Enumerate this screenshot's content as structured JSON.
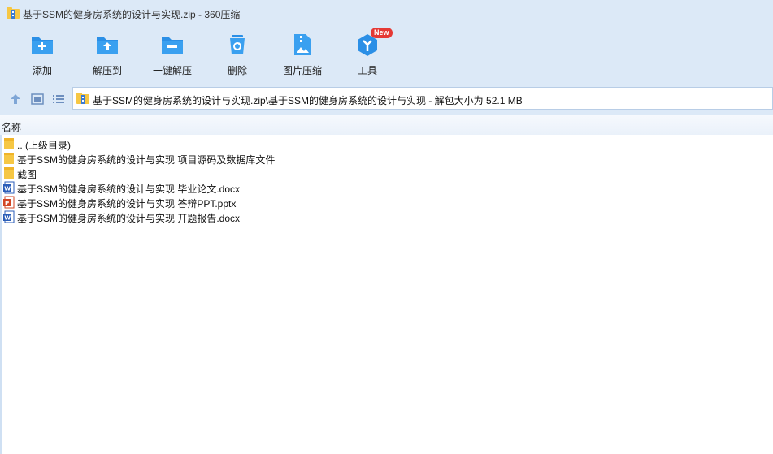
{
  "window": {
    "title": "基于SSM的健身房系统的设计与实现.zip - 360压缩",
    "app_icon": "zip-archive-icon"
  },
  "toolbar": {
    "items": [
      {
        "label": "添加",
        "icon": "add-folder-icon"
      },
      {
        "label": "解压到",
        "icon": "extract-to-icon"
      },
      {
        "label": "一键解压",
        "icon": "one-click-extract-icon"
      },
      {
        "label": "删除",
        "icon": "recycle-bin-icon"
      },
      {
        "label": "图片压缩",
        "icon": "image-compress-icon"
      },
      {
        "label": "工具",
        "icon": "tools-icon",
        "badge": "New"
      }
    ]
  },
  "navbar": {
    "up_icon": "up-arrow-icon",
    "view_thumb_icon": "thumbnail-view-icon",
    "view_list_icon": "list-view-icon",
    "path": "基于SSM的健身房系统的设计与实现.zip\\基于SSM的健身房系统的设计与实现 - 解包大小为 52.1 MB"
  },
  "columns": {
    "name": "名称"
  },
  "files": [
    {
      "name": ".. (上级目录)",
      "icon": "folder-icon"
    },
    {
      "name": "基于SSM的健身房系统的设计与实现 项目源码及数据库文件",
      "icon": "folder-icon"
    },
    {
      "name": "截图",
      "icon": "folder-icon"
    },
    {
      "name": "基于SSM的健身房系统的设计与实现 毕业论文.docx",
      "icon": "word-doc-icon"
    },
    {
      "name": "基于SSM的健身房系统的设计与实现 答辩PPT.pptx",
      "icon": "powerpoint-icon"
    },
    {
      "name": "基于SSM的健身房系统的设计与实现 开题报告.docx",
      "icon": "word-doc-icon"
    }
  ],
  "colors": {
    "chrome_bg": "#dce9f7",
    "toolbar_icon_blue": "#2b8fe6",
    "badge_red": "#e53935",
    "folder_yellow": "#f6c744",
    "word_blue": "#2b5eb8",
    "ppt_orange": "#d24726"
  }
}
